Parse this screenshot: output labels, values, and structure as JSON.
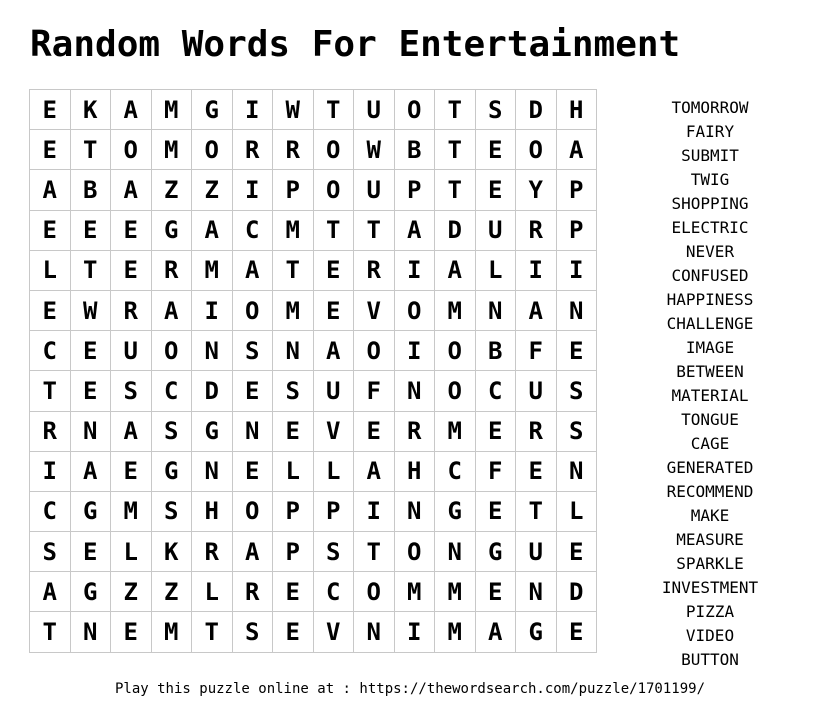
{
  "title": "Random Words For Entertainment",
  "grid": {
    "rows": [
      [
        "E",
        "K",
        "A",
        "M",
        "G",
        "I",
        "W",
        "T",
        "U",
        "O",
        "T",
        "S",
        "D",
        "H"
      ],
      [
        "E",
        "T",
        "O",
        "M",
        "O",
        "R",
        "R",
        "O",
        "W",
        "B",
        "T",
        "E",
        "O",
        "A"
      ],
      [
        "A",
        "B",
        "A",
        "Z",
        "Z",
        "I",
        "P",
        "O",
        "U",
        "P",
        "T",
        "E",
        "Y",
        "P"
      ],
      [
        "E",
        "E",
        "E",
        "G",
        "A",
        "C",
        "M",
        "T",
        "T",
        "A",
        "D",
        "U",
        "R",
        "P"
      ],
      [
        "L",
        "T",
        "E",
        "R",
        "M",
        "A",
        "T",
        "E",
        "R",
        "I",
        "A",
        "L",
        "I",
        "I"
      ],
      [
        "E",
        "W",
        "R",
        "A",
        "I",
        "O",
        "M",
        "E",
        "V",
        "O",
        "M",
        "N",
        "A",
        "N"
      ],
      [
        "C",
        "E",
        "U",
        "O",
        "N",
        "S",
        "N",
        "A",
        "O",
        "I",
        "O",
        "B",
        "F",
        "E"
      ],
      [
        "T",
        "E",
        "S",
        "C",
        "D",
        "E",
        "S",
        "U",
        "F",
        "N",
        "O",
        "C",
        "U",
        "S"
      ],
      [
        "R",
        "N",
        "A",
        "S",
        "G",
        "N",
        "E",
        "V",
        "E",
        "R",
        "M",
        "E",
        "R",
        "S"
      ],
      [
        "I",
        "A",
        "E",
        "G",
        "N",
        "E",
        "L",
        "L",
        "A",
        "H",
        "C",
        "F",
        "E",
        "N"
      ],
      [
        "C",
        "G",
        "M",
        "S",
        "H",
        "O",
        "P",
        "P",
        "I",
        "N",
        "G",
        "E",
        "T",
        "L"
      ],
      [
        "S",
        "E",
        "L",
        "K",
        "R",
        "A",
        "P",
        "S",
        "T",
        "O",
        "N",
        "G",
        "U",
        "E"
      ],
      [
        "A",
        "G",
        "Z",
        "Z",
        "L",
        "R",
        "E",
        "C",
        "O",
        "M",
        "M",
        "E",
        "N",
        "D"
      ],
      [
        "T",
        "N",
        "E",
        "M",
        "T",
        "S",
        "E",
        "V",
        "N",
        "I",
        "M",
        "A",
        "G",
        "E"
      ]
    ]
  },
  "words": [
    "TOMORROW",
    "FAIRY",
    "SUBMIT",
    "TWIG",
    "SHOPPING",
    "ELECTRIC",
    "NEVER",
    "CONFUSED",
    "HAPPINESS",
    "CHALLENGE",
    "IMAGE",
    "BETWEEN",
    "MATERIAL",
    "TONGUE",
    "CAGE",
    "GENERATED",
    "RECOMMEND",
    "MAKE",
    "MEASURE",
    "SPARKLE",
    "INVESTMENT",
    "PIZZA",
    "VIDEO",
    "BUTTON"
  ],
  "footer": "Play this puzzle online at : https://thewordsearch.com/puzzle/1701199/"
}
